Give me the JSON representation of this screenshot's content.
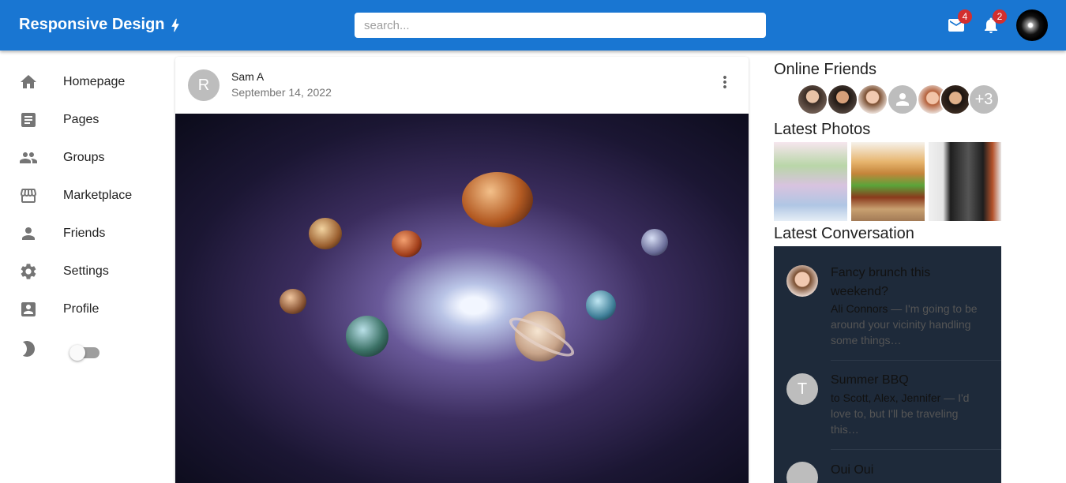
{
  "app": {
    "title": "Responsive Design"
  },
  "search": {
    "placeholder": "search..."
  },
  "header": {
    "mail_badge": "4",
    "notif_badge": "2"
  },
  "sidebar": {
    "items": [
      {
        "label": "Homepage",
        "icon": "home-icon"
      },
      {
        "label": "Pages",
        "icon": "article-icon"
      },
      {
        "label": "Groups",
        "icon": "groups-icon"
      },
      {
        "label": "Marketplace",
        "icon": "storefront-icon"
      },
      {
        "label": "Friends",
        "icon": "person-icon"
      },
      {
        "label": "Settings",
        "icon": "gear-icon"
      },
      {
        "label": "Profile",
        "icon": "account-box-icon"
      }
    ],
    "dark_mode": false
  },
  "post": {
    "avatar_letter": "R",
    "author": "Sam A",
    "date": "September 14, 2022"
  },
  "right": {
    "online_title": "Online Friends",
    "more_count": "+3",
    "photos_title": "Latest Photos",
    "conversation_title": "Latest Conversation",
    "messages": [
      {
        "title": "Fancy brunch this weekend?",
        "sender": "Ali Connors",
        "snippet": " — I'm going to be around your vicinity handling some things…"
      },
      {
        "avatar_letter": "T",
        "title": "Summer BBQ",
        "sender": "to Scott, Alex, Jennifer",
        "snippet": " — I'd love to, but I'll be traveling this…"
      },
      {
        "title": "Oui Oui"
      }
    ]
  },
  "colors": {
    "primary": "#1976d2",
    "badge": "#d32f2f",
    "conversation_bg": "#1e2a3a"
  }
}
